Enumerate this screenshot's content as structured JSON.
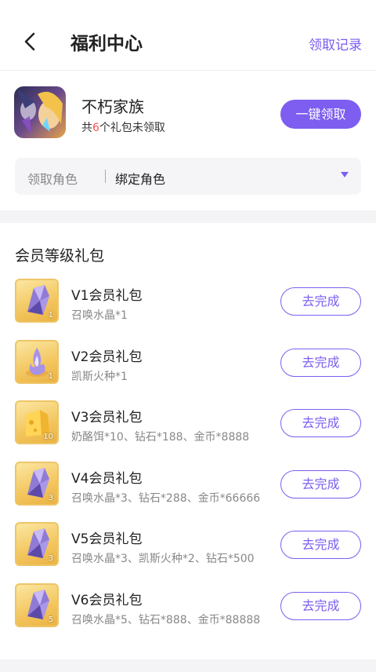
{
  "nav": {
    "title": "福利中心",
    "record_label": "领取记录"
  },
  "game": {
    "name": "不朽家族",
    "pending_prefix": "共",
    "pending_count": "6",
    "pending_suffix": "个礼包未领取",
    "claim_all_label": "一键领取"
  },
  "role": {
    "label": "领取角色",
    "value": "绑定角色"
  },
  "section": {
    "title": "会员等级礼包"
  },
  "packages": [
    {
      "name": "V1会员礼包",
      "desc": "召唤水晶*1",
      "qty": "1",
      "icon": "crystal-icon",
      "button": "去完成"
    },
    {
      "name": "V2会员礼包",
      "desc": "凯斯火种*1",
      "qty": "1",
      "icon": "flame-icon",
      "button": "去完成"
    },
    {
      "name": "V3会员礼包",
      "desc": "奶酪饵*10、钻石*188、金币*8888",
      "qty": "10",
      "icon": "cheese-icon",
      "button": "去完成"
    },
    {
      "name": "V4会员礼包",
      "desc": "召唤水晶*3、钻石*288、金币*66666",
      "qty": "3",
      "icon": "crystal-icon",
      "button": "去完成"
    },
    {
      "name": "V5会员礼包",
      "desc": "召唤水晶*3、凯斯火种*2、钻石*500",
      "qty": "3",
      "icon": "crystal-icon",
      "button": "去完成"
    },
    {
      "name": "V6会员礼包",
      "desc": "召唤水晶*5、钻石*888、金币*88888",
      "qty": "5",
      "icon": "crystal-icon",
      "button": "去完成"
    }
  ],
  "colors": {
    "accent": "#7d5ef0",
    "highlight": "#ff4d4f"
  }
}
